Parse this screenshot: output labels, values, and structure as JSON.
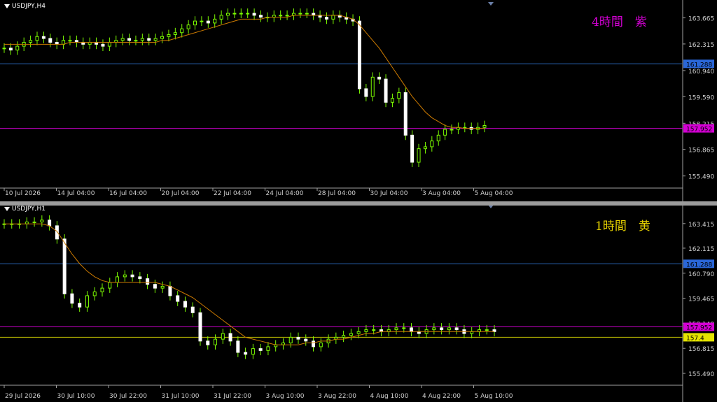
{
  "charts": [
    {
      "symbol": "USDJPY,H4",
      "overlay_text": "4時間　紫",
      "overlay_color": "#d400d4",
      "y_ticks": [
        "163.665",
        "162.315",
        "160.940",
        "159.590",
        "158.215",
        "156.865",
        "155.490"
      ],
      "x_ticks": [
        "10 Jul 2026",
        "14 Jul 04:00",
        "16 Jul 04:00",
        "20 Jul 04:00",
        "22 Jul 04:00",
        "24 Jul 04:00",
        "28 Jul 04:00",
        "30 Jul 04:00",
        "3 Aug 04:00",
        "5 Aug 04:00"
      ],
      "hlines": [
        {
          "value": 161.288,
          "label": "161.288",
          "color": "#2a67b8",
          "label_bg": "#2a67d8"
        },
        {
          "value": 157.952,
          "label": "157.952",
          "color": "#c800c8",
          "label_bg": "#d400d4"
        }
      ],
      "chart_data": {
        "type": "candlestick",
        "symbol": "USDJPY",
        "timeframe": "H4",
        "y_range": [
          154.9,
          164.3
        ],
        "moving_average_color": "#cc7a00",
        "candle_color": "#7cfc00",
        "closes": [
          162.1,
          162.0,
          162.2,
          162.4,
          162.5,
          162.7,
          162.6,
          162.4,
          162.3,
          162.5,
          162.5,
          162.4,
          162.3,
          162.4,
          162.3,
          162.2,
          162.4,
          162.5,
          162.6,
          162.5,
          162.5,
          162.6,
          162.5,
          162.6,
          162.7,
          162.8,
          162.9,
          163.1,
          163.3,
          163.5,
          163.5,
          163.4,
          163.6,
          163.8,
          163.9,
          163.9,
          163.9,
          163.9,
          163.8,
          163.7,
          163.7,
          163.8,
          163.8,
          163.8,
          163.9,
          163.9,
          163.9,
          163.8,
          163.7,
          163.6,
          163.8,
          163.7,
          163.6,
          163.5,
          160.0,
          159.6,
          160.6,
          160.5,
          159.3,
          159.5,
          159.8,
          157.6,
          156.2,
          156.9,
          157.0,
          157.3,
          157.6,
          157.9,
          157.9,
          158.0,
          158.0,
          157.9,
          158.0,
          158.1
        ],
        "moving_average": [
          162.3,
          162.3,
          162.3,
          162.3,
          162.3,
          162.3,
          162.3,
          162.3,
          162.3,
          162.3,
          162.4,
          162.4,
          162.4,
          162.4,
          162.4,
          162.4,
          162.4,
          162.4,
          162.4,
          162.4,
          162.4,
          162.4,
          162.4,
          162.4,
          162.5,
          162.5,
          162.6,
          162.7,
          162.8,
          162.9,
          163.0,
          163.1,
          163.2,
          163.3,
          163.4,
          163.5,
          163.6,
          163.6,
          163.6,
          163.6,
          163.7,
          163.7,
          163.7,
          163.7,
          163.8,
          163.8,
          163.8,
          163.8,
          163.8,
          163.8,
          163.8,
          163.8,
          163.7,
          163.6,
          163.3,
          162.9,
          162.5,
          162.1,
          161.6,
          161.1,
          160.6,
          160.1,
          159.6,
          159.2,
          158.8,
          158.5,
          158.3,
          158.1,
          158.0,
          158.0,
          157.95,
          157.95,
          157.95,
          157.95
        ]
      }
    },
    {
      "symbol": "USDJPY,H1",
      "overlay_text": "1時間　黄",
      "overlay_color": "#e6d200",
      "y_ticks": [
        "163.415",
        "162.115",
        "160.790",
        "159.465",
        "158.140",
        "156.815",
        "155.490"
      ],
      "x_ticks": [
        "29 Jul 2026",
        "30 Jul 10:00",
        "30 Jul 22:00",
        "31 Jul 10:00",
        "31 Jul 22:00",
        "3 Aug 10:00",
        "3 Aug 22:00",
        "4 Aug 10:00",
        "4 Aug 22:00",
        "5 Aug 10:00"
      ],
      "hlines": [
        {
          "value": 161.288,
          "label": "161.288",
          "color": "#2a67b8",
          "label_bg": "#2a67d8"
        },
        {
          "value": 157.952,
          "label": "157.952",
          "color": "#c800c8",
          "label_bg": "#d400d4"
        },
        {
          "value": 157.4,
          "label": "157.4",
          "color": "#c8c800",
          "label_bg": "#e6e600"
        }
      ],
      "chart_data": {
        "type": "candlestick",
        "symbol": "USDJPY",
        "timeframe": "H1",
        "y_range": [
          154.9,
          164.0
        ],
        "moving_average_color": "#cc7a00",
        "candle_color": "#7cfc00",
        "closes": [
          163.4,
          163.4,
          163.4,
          163.5,
          163.5,
          163.6,
          163.3,
          162.6,
          159.7,
          159.2,
          159.0,
          159.6,
          159.8,
          160.0,
          160.3,
          160.6,
          160.7,
          160.6,
          160.5,
          160.2,
          160.0,
          160.1,
          159.6,
          159.3,
          159.0,
          158.7,
          157.2,
          157.0,
          157.3,
          157.6,
          157.2,
          156.6,
          156.5,
          156.8,
          156.7,
          156.9,
          157.0,
          157.1,
          157.4,
          157.3,
          157.2,
          156.9,
          157.1,
          157.3,
          157.4,
          157.5,
          157.6,
          157.7,
          157.8,
          157.8,
          157.7,
          157.8,
          157.9,
          157.9,
          157.7,
          157.6,
          157.8,
          157.9,
          157.8,
          157.9,
          157.8,
          157.6,
          157.7,
          157.8,
          157.8,
          157.7
        ],
        "moving_average": [
          163.4,
          163.4,
          163.4,
          163.4,
          163.4,
          163.4,
          163.3,
          163.0,
          162.4,
          161.8,
          161.3,
          160.9,
          160.6,
          160.4,
          160.3,
          160.3,
          160.3,
          160.3,
          160.3,
          160.3,
          160.3,
          160.2,
          160.1,
          159.9,
          159.7,
          159.5,
          159.2,
          158.9,
          158.6,
          158.3,
          158.0,
          157.7,
          157.4,
          157.3,
          157.2,
          157.1,
          157.0,
          157.0,
          157.0,
          157.0,
          157.1,
          157.1,
          157.2,
          157.2,
          157.3,
          157.3,
          157.4,
          157.5,
          157.6,
          157.6,
          157.7,
          157.7,
          157.7,
          157.7,
          157.7,
          157.7,
          157.7,
          157.7,
          157.7,
          157.7,
          157.7,
          157.7,
          157.7,
          157.7,
          157.7,
          157.7
        ]
      }
    }
  ]
}
